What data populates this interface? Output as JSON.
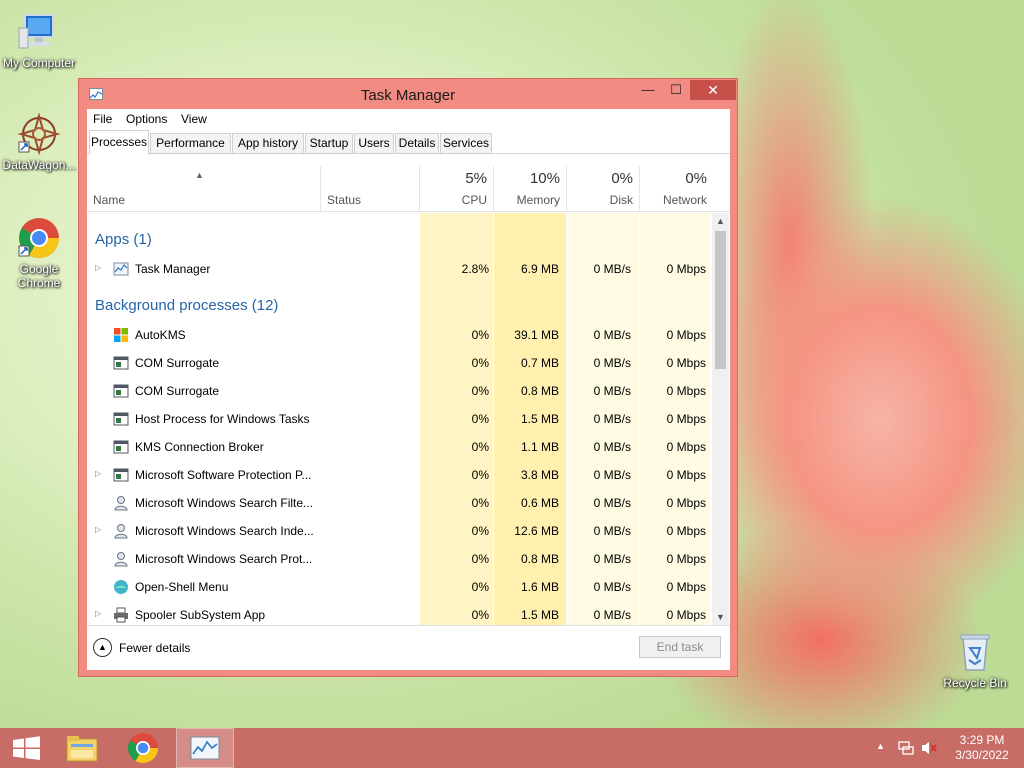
{
  "desktop": {
    "icons": [
      {
        "label": "My Computer"
      },
      {
        "label": "DataWagon..."
      },
      {
        "label": "Google Chrome"
      },
      {
        "label": "Recycle Bin"
      }
    ]
  },
  "window": {
    "title": "Task Manager",
    "controls": {
      "minimize": "—",
      "maximize": "☐",
      "close": "✕"
    }
  },
  "menu": [
    "File",
    "Options",
    "View"
  ],
  "tabs": [
    "Processes",
    "Performance",
    "App history",
    "Startup",
    "Users",
    "Details",
    "Services"
  ],
  "active_tab": "Processes",
  "columns": {
    "name": "Name",
    "status": "Status",
    "cpu": {
      "pct": "5%",
      "label": "CPU"
    },
    "memory": {
      "pct": "10%",
      "label": "Memory"
    },
    "disk": {
      "pct": "0%",
      "label": "Disk"
    },
    "network": {
      "pct": "0%",
      "label": "Network"
    }
  },
  "groups": {
    "apps": {
      "label": "Apps (1)",
      "rows": [
        {
          "name": "Task Manager",
          "cpu": "2.8%",
          "mem": "6.9 MB",
          "disk": "0 MB/s",
          "net": "0 Mbps",
          "expandable": true,
          "icon": "task-manager-icon"
        }
      ]
    },
    "background": {
      "label": "Background processes (12)",
      "rows": [
        {
          "name": "AutoKMS",
          "cpu": "0%",
          "mem": "39.1 MB",
          "disk": "0 MB/s",
          "net": "0 Mbps",
          "expandable": false,
          "icon": "windows-logo-icon"
        },
        {
          "name": "COM Surrogate",
          "cpu": "0%",
          "mem": "0.7 MB",
          "disk": "0 MB/s",
          "net": "0 Mbps",
          "expandable": false,
          "icon": "process-window-icon"
        },
        {
          "name": "COM Surrogate",
          "cpu": "0%",
          "mem": "0.8 MB",
          "disk": "0 MB/s",
          "net": "0 Mbps",
          "expandable": false,
          "icon": "process-window-icon"
        },
        {
          "name": "Host Process for Windows Tasks",
          "cpu": "0%",
          "mem": "1.5 MB",
          "disk": "0 MB/s",
          "net": "0 Mbps",
          "expandable": false,
          "icon": "process-window-icon"
        },
        {
          "name": "KMS Connection Broker",
          "cpu": "0%",
          "mem": "1.1 MB",
          "disk": "0 MB/s",
          "net": "0 Mbps",
          "expandable": false,
          "icon": "process-window-icon"
        },
        {
          "name": "Microsoft Software Protection P...",
          "cpu": "0%",
          "mem": "3.8 MB",
          "disk": "0 MB/s",
          "net": "0 Mbps",
          "expandable": true,
          "icon": "process-window-icon"
        },
        {
          "name": "Microsoft Windows Search Filte...",
          "cpu": "0%",
          "mem": "0.6 MB",
          "disk": "0 MB/s",
          "net": "0 Mbps",
          "expandable": false,
          "icon": "search-user-icon"
        },
        {
          "name": "Microsoft Windows Search Inde...",
          "cpu": "0%",
          "mem": "12.6 MB",
          "disk": "0 MB/s",
          "net": "0 Mbps",
          "expandable": true,
          "icon": "search-user-icon"
        },
        {
          "name": "Microsoft Windows Search Prot...",
          "cpu": "0%",
          "mem": "0.8 MB",
          "disk": "0 MB/s",
          "net": "0 Mbps",
          "expandable": false,
          "icon": "search-user-icon"
        },
        {
          "name": "Open-Shell Menu",
          "cpu": "0%",
          "mem": "1.6 MB",
          "disk": "0 MB/s",
          "net": "0 Mbps",
          "expandable": false,
          "icon": "shell-orb-icon"
        },
        {
          "name": "Spooler SubSystem App",
          "cpu": "0%",
          "mem": "1.5 MB",
          "disk": "0 MB/s",
          "net": "0 Mbps",
          "expandable": true,
          "icon": "printer-icon"
        }
      ]
    }
  },
  "footer": {
    "fewer_details": "Fewer details",
    "end_task": "End task"
  },
  "taskbar": {
    "buttons": [
      "start-button",
      "file-explorer",
      "google-chrome",
      "task-manager"
    ],
    "clock": {
      "time": "3:29 PM",
      "date": "3/30/2022"
    }
  },
  "colors": {
    "window_frame": "#f28b82",
    "close_button": "#c7504b",
    "taskbar": "#c86c66",
    "group_label": "#2566a8",
    "cpu_column": "#fff4c4",
    "mem_column": "#fff0b0",
    "col_light": "#fffae2"
  }
}
